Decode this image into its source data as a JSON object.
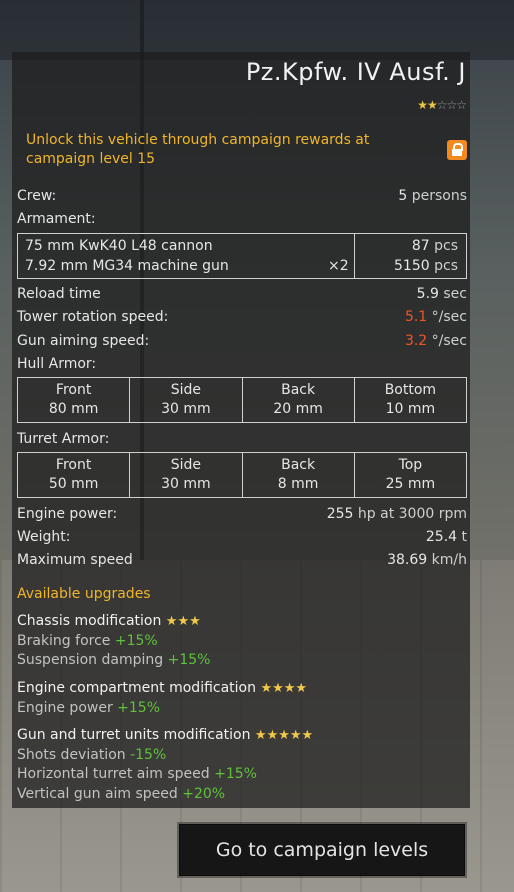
{
  "vehicle": {
    "name": "Pz.Kpfw. IV Ausf. J",
    "rating_filled": "★★",
    "rating_empty": "☆☆☆",
    "unlock_message": "Unlock this vehicle through campaign rewards at campaign level 15"
  },
  "stats": {
    "crew_label": "Crew:",
    "crew_value": "5",
    "crew_unit": "persons",
    "armament_label": "Armament:",
    "armament": [
      {
        "name": "75 mm KwK40 L48 cannon",
        "multiplier": "",
        "count": "87",
        "unit": "pcs"
      },
      {
        "name": "7.92 mm MG34 machine gun",
        "multiplier": "×2",
        "count": "5150",
        "unit": "pcs"
      }
    ],
    "reload_label": "Reload time",
    "reload_value": "5.9",
    "reload_unit": "sec",
    "tower_label": "Tower rotation speed:",
    "tower_value": "5.1",
    "tower_unit": "°/sec",
    "aim_label": "Gun aiming speed:",
    "aim_value": "3.2",
    "aim_unit": "°/sec",
    "hull_label": "Hull Armor:",
    "hull_armor": [
      {
        "label": "Front",
        "value": "80 mm"
      },
      {
        "label": "Side",
        "value": "30 mm"
      },
      {
        "label": "Back",
        "value": "20 mm"
      },
      {
        "label": "Bottom",
        "value": "10 mm"
      }
    ],
    "turret_label": "Turret Armor:",
    "turret_armor": [
      {
        "label": "Front",
        "value": "50 mm"
      },
      {
        "label": "Side",
        "value": "30 mm"
      },
      {
        "label": "Back",
        "value": "8 mm"
      },
      {
        "label": "Top",
        "value": "25 mm"
      }
    ],
    "engine_label": "Engine power:",
    "engine_value": "255",
    "engine_unit": "hp at 3000 rpm",
    "weight_label": "Weight:",
    "weight_value": "25.4",
    "weight_unit": "t",
    "speed_label": "Maximum speed",
    "speed_value": "38.69",
    "speed_unit": "km/h"
  },
  "upgrades": {
    "heading": "Available upgrades",
    "groups": [
      {
        "title": "Chassis modification",
        "stars": "★★★",
        "effects": [
          {
            "label": "Braking force",
            "value": "+15%"
          },
          {
            "label": "Suspension damping",
            "value": "+15%"
          }
        ]
      },
      {
        "title": "Engine compartment modification",
        "stars": "★★★★",
        "effects": [
          {
            "label": "Engine power",
            "value": "+15%"
          }
        ]
      },
      {
        "title": "Gun and turret units modification",
        "stars": "★★★★★",
        "effects": [
          {
            "label": "Shots deviation",
            "value": "-15%"
          },
          {
            "label": "Horizontal turret aim speed",
            "value": "+15%"
          },
          {
            "label": "Vertical gun aim speed",
            "value": "+20%"
          }
        ]
      }
    ]
  },
  "actions": {
    "campaign_button": "Go to campaign levels"
  },
  "colors": {
    "accent_gold": "#f0b629",
    "warn_orange": "#f0562a",
    "positive_green": "#5fc23a",
    "lock_badge": "#f28a1e"
  },
  "icons": {
    "lock": "lock-icon"
  }
}
